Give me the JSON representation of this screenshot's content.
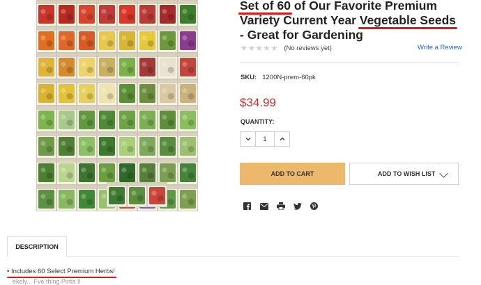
{
  "product": {
    "title_parts": {
      "set_of": "Set of 60",
      "mid": " of Our Favorite Premium Variety Current Year ",
      "vegetable_seeds": "Vegetable Seeds",
      "end": " - Great for Gardening"
    },
    "reviews_text": "(No reviews yet)",
    "write_review": "Write a Review",
    "sku_label": "SKU:",
    "sku_value": "1200N-prem-60pk",
    "price": "$34.99",
    "quantity_label": "QUANTITY:",
    "quantity_value": "1",
    "add_to_cart": "ADD TO CART",
    "add_to_wishlist": "ADD TO WISH LIST"
  },
  "tabs": {
    "description": "DESCRIPTION"
  },
  "description": {
    "bullet1": "Includes 60 Select Premium Herbs!",
    "bullet2_partial": "ekely... Fve thing Pinta Il"
  },
  "colors": {
    "price": "#c4322c",
    "add_to_cart": "#ecb86c",
    "link": "#2a64b5",
    "annotation": "#d71a1a"
  },
  "icons": [
    "star-icon",
    "minus-icon",
    "plus-icon",
    "chevron-down-icon",
    "facebook-icon",
    "email-icon",
    "print-icon",
    "twitter-icon",
    "pinterest-icon"
  ]
}
